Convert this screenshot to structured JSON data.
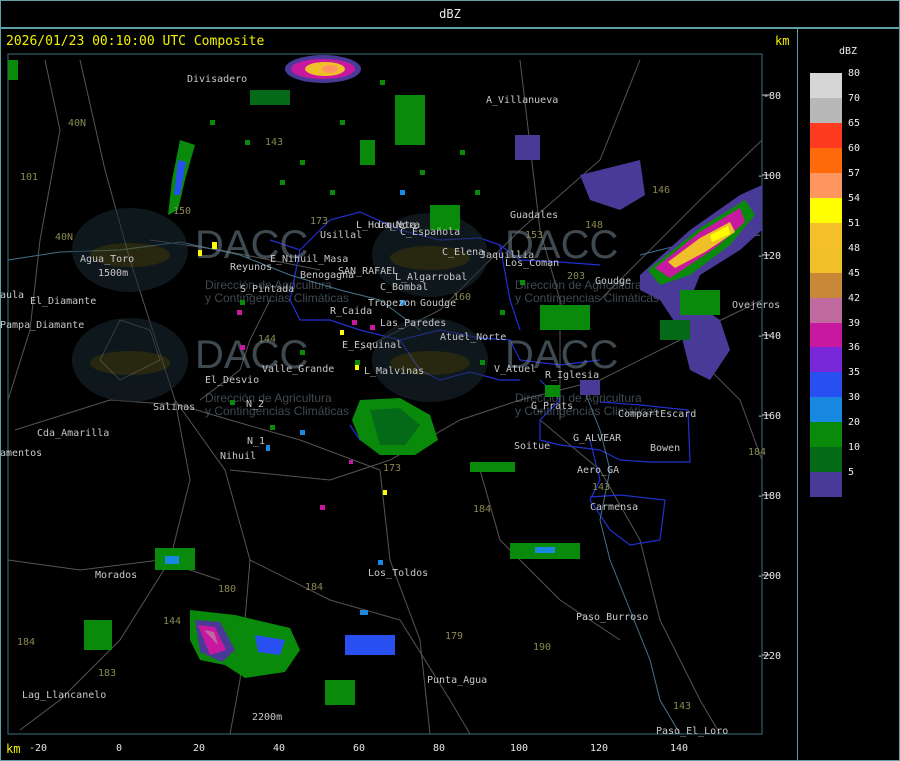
{
  "header": {
    "title": "dBZ"
  },
  "map": {
    "timestamp": "2026/01/23 00:10:00 UTC Composite",
    "km_label_top": "km",
    "km_label_bottom": "km",
    "y_ticks": [
      "-80",
      "-100",
      "-120",
      "-140",
      "-160",
      "-180",
      "-200",
      "-220"
    ],
    "x_ticks": [
      "-20",
      "0",
      "20",
      "40",
      "60",
      "80",
      "100",
      "120",
      "140"
    ],
    "watermark": {
      "text": "DACC",
      "subtitle_1": "Dirección de Agricultura",
      "subtitle_2": "y Contingencias Climáticas"
    },
    "places": [
      "Divisadero",
      "A_Villanueva",
      "Guadales",
      "Usillal",
      "L_Horqueta",
      "C_Española",
      "C_Elena",
      "Jaquillia",
      "Los_Coman",
      "Goudge",
      "Agua_Toro",
      "Reyunos",
      "E_Nihuil_Masa",
      "Benogagna",
      "SAN_RAFAEL",
      "L_Algarrobal",
      "C_Bombal",
      "S_Pintada",
      "Tropezon",
      "Goudge",
      "R_Caida",
      "Las_Paredes",
      "Atuel_Norte",
      "Pampa_Diamante",
      "El_Diamante",
      "E_Esquinal",
      "L_Malvinas",
      "V_Atuel",
      "R_Iglesia",
      "El_Desvio",
      "Valle_Grande",
      "Salinas",
      "N_2",
      "G_Prats",
      "CompartEscard",
      "Cda_Amarilla",
      "N_1",
      "G_ALVEAR",
      "Nihuil",
      "Soitue",
      "Bowen",
      "amentos",
      "Aero_GA",
      "Carmensa",
      "Morados",
      "Los_Toldos",
      "Paso_Burroso",
      "Punta_Agua",
      "Lag_Llancanelo",
      "Paso_El_Loro",
      "Ovejeros",
      "aula",
      "La_Nora",
      "2200m",
      "1500m"
    ],
    "route_numbers": [
      "101",
      "143",
      "150",
      "40N",
      "40N",
      "144",
      "173",
      "184",
      "180",
      "184",
      "179",
      "190",
      "183",
      "184",
      "173",
      "143",
      "146",
      "153",
      "203",
      "148",
      "143",
      "144",
      "160",
      "184"
    ]
  },
  "legend": {
    "title": "dBZ",
    "levels": [
      {
        "label": "80",
        "color": "#d6d6d6"
      },
      {
        "label": "70",
        "color": "#b8b8b8"
      },
      {
        "label": "65",
        "color": "#ff3b1f"
      },
      {
        "label": "60",
        "color": "#ff6a0a"
      },
      {
        "label": "57",
        "color": "#ff9660"
      },
      {
        "label": "54",
        "color": "#ffff00"
      },
      {
        "label": "51",
        "color": "#f5c02a"
      },
      {
        "label": "48",
        "color": "#f0c028"
      },
      {
        "label": "45",
        "color": "#c88838"
      },
      {
        "label": "42",
        "color": "#c06aa0"
      },
      {
        "label": "39",
        "color": "#c818a0"
      },
      {
        "label": "36",
        "color": "#7828d8"
      },
      {
        "label": "35",
        "color": "#2850f0"
      },
      {
        "label": "30",
        "color": "#1888e0"
      },
      {
        "label": "20",
        "color": "#0a8a0a"
      },
      {
        "label": "10",
        "color": "#056a18"
      },
      {
        "label": "5",
        "color": "#4a3a98"
      }
    ]
  }
}
